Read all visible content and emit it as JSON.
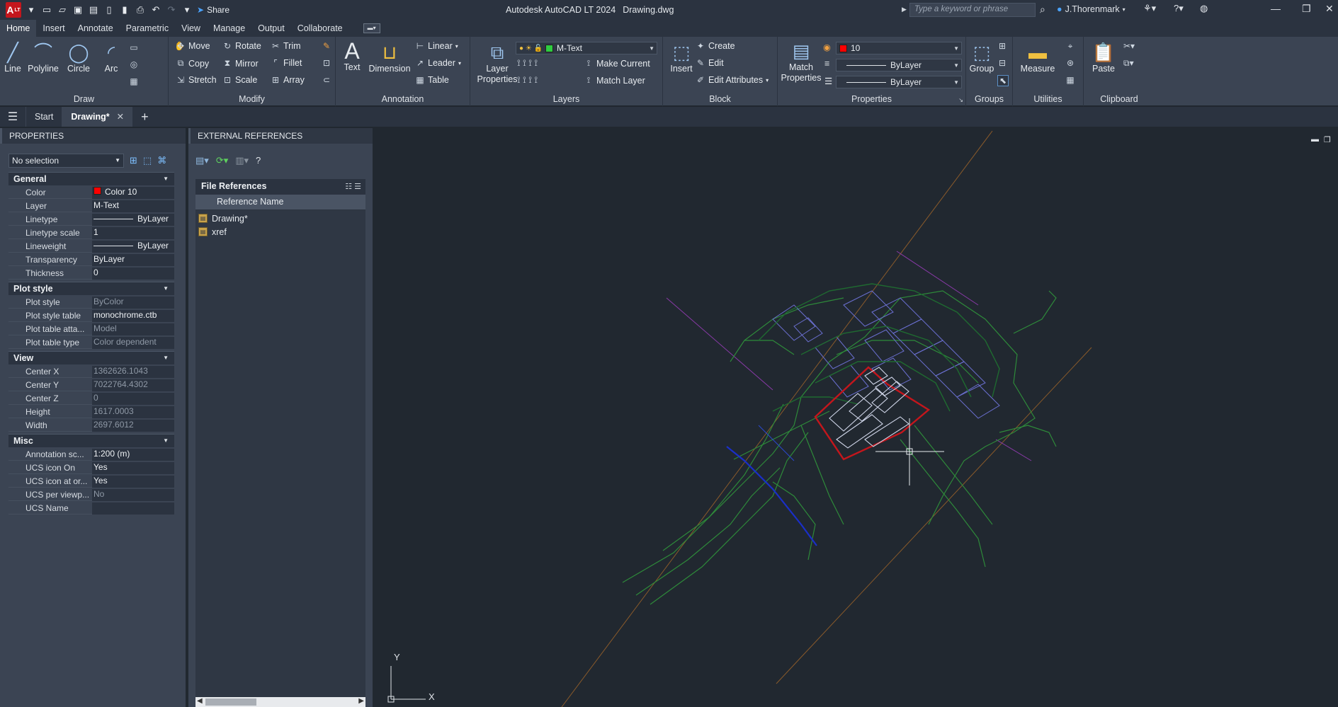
{
  "titlebar": {
    "logo_text": "A",
    "logo_sub": "LT",
    "app_name": "Autodesk AutoCAD LT 2024",
    "file_name": "Drawing.dwg",
    "share_label": "Share",
    "search_placeholder": "Type a keyword or phrase",
    "user_name": "J.Thorenmark"
  },
  "ribbon_tabs": [
    "Home",
    "Insert",
    "Annotate",
    "Parametric",
    "View",
    "Manage",
    "Output",
    "Collaborate"
  ],
  "ribbon": {
    "draw": {
      "title": "Draw",
      "line": "Line",
      "polyline": "Polyline",
      "circle": "Circle",
      "arc": "Arc"
    },
    "modify": {
      "title": "Modify",
      "move": "Move",
      "rotate": "Rotate",
      "trim": "Trim",
      "copy": "Copy",
      "mirror": "Mirror",
      "fillet": "Fillet",
      "stretch": "Stretch",
      "scale": "Scale",
      "array": "Array"
    },
    "annotation": {
      "title": "Annotation",
      "text": "Text",
      "dimension": "Dimension",
      "linear": "Linear",
      "leader": "Leader",
      "table": "Table"
    },
    "layers": {
      "title": "Layers",
      "layer_properties_1": "Layer",
      "layer_properties_2": "Properties",
      "current_layer": "M-Text",
      "make_current": "Make Current",
      "match_layer": "Match Layer",
      "layer_color": "#2ecc40"
    },
    "block": {
      "title": "Block",
      "insert": "Insert",
      "create": "Create",
      "edit": "Edit",
      "edit_attributes": "Edit Attributes"
    },
    "properties": {
      "title": "Properties",
      "match_1": "Match",
      "match_2": "Properties",
      "color_value": "10",
      "color_swatch": "#ff0000",
      "linetype": "ByLayer",
      "lineweight": "ByLayer"
    },
    "groups": {
      "title": "Groups",
      "group": "Group"
    },
    "utilities": {
      "title": "Utilities",
      "measure": "Measure"
    },
    "clipboard": {
      "title": "Clipboard",
      "paste": "Paste"
    }
  },
  "doc_tabs": {
    "start": "Start",
    "drawing": "Drawing*"
  },
  "properties_palette": {
    "title": "PROPERTIES",
    "selection": "No selection",
    "general": {
      "header": "General",
      "color_label": "Color",
      "color_value": "Color 10",
      "color_swatch": "#ff0000",
      "layer_label": "Layer",
      "layer_value": "M-Text",
      "linetype_label": "Linetype",
      "linetype_value": "ByLayer",
      "ltscale_label": "Linetype scale",
      "ltscale_value": "1",
      "lineweight_label": "Lineweight",
      "lineweight_value": "ByLayer",
      "transparency_label": "Transparency",
      "transparency_value": "ByLayer",
      "thickness_label": "Thickness",
      "thickness_value": "0"
    },
    "plot_style": {
      "header": "Plot style",
      "style_label": "Plot style",
      "style_value": "ByColor",
      "table_label": "Plot style table",
      "table_value": "monochrome.ctb",
      "attach_label": "Plot table atta...",
      "attach_value": "Model",
      "type_label": "Plot table type",
      "type_value": "Color dependent"
    },
    "view": {
      "header": "View",
      "cx_label": "Center X",
      "cx_value": "1362626.1043",
      "cy_label": "Center Y",
      "cy_value": "7022764.4302",
      "cz_label": "Center Z",
      "cz_value": "0",
      "height_label": "Height",
      "height_value": "1617.0003",
      "width_label": "Width",
      "width_value": "2697.6012"
    },
    "misc": {
      "header": "Misc",
      "annoscale_label": "Annotation sc...",
      "annoscale_value": "1:200 (m)",
      "ucson_label": "UCS icon On",
      "ucson_value": "Yes",
      "ucsorigin_label": "UCS icon at or...",
      "ucsorigin_value": "Yes",
      "ucsvp_label": "UCS per viewp...",
      "ucsvp_value": "No",
      "ucsname_label": "UCS Name",
      "ucsname_value": ""
    }
  },
  "xref_palette": {
    "title": "EXTERNAL REFERENCES",
    "file_references": "File References",
    "column_header": "Reference Name",
    "items": [
      "Drawing*",
      "xref"
    ]
  },
  "canvas": {
    "ucs_x": "X",
    "ucs_y": "Y"
  }
}
